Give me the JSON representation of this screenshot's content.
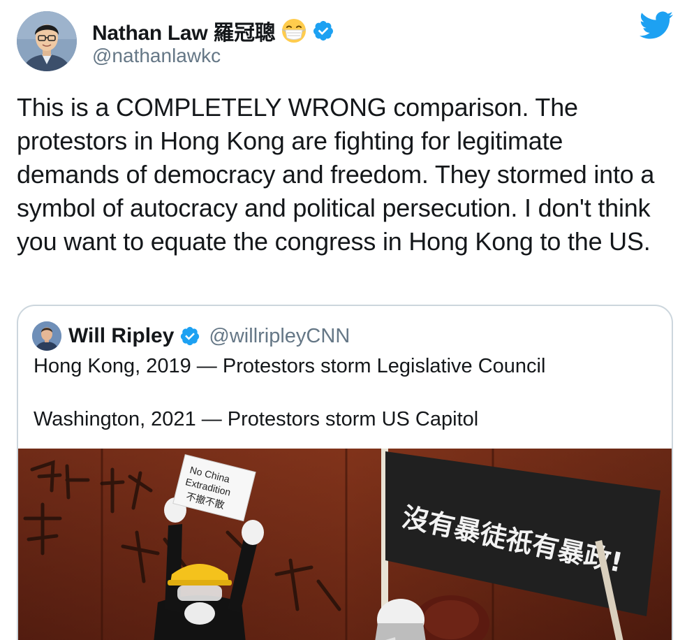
{
  "author": {
    "display_name": "Nathan Law 羅冠聰",
    "handle": "@nathanlawkc",
    "emoji": "face-with-medical-mask-icon",
    "verified": true
  },
  "tweet": {
    "text": "This is a COMPLETELY WRONG comparison. The protestors in Hong Kong are fighting for legitimate demands of democracy and freedom. They stormed into a symbol of autocracy and political persecution. I don't think you want to equate the congress in Hong Kong to the US."
  },
  "quoted_tweet": {
    "display_name": "Will Ripley",
    "handle": "@willripleyCNN",
    "verified": true,
    "line_1": "Hong Kong, 2019 — Protestors storm Legislative Council",
    "line_2": "Washington, 2021 — Protestors storm US Capitol",
    "image": {
      "placard_line_1": "No China",
      "placard_line_2": "Extradition",
      "placard_line_3": "不撤不散",
      "banner_text": "沒有暴徒祇有暴政!"
    }
  },
  "colors": {
    "twitter_blue": "#1da1f2",
    "text_primary": "#14171a",
    "text_secondary": "#657786",
    "card_border": "#ccd6dd"
  }
}
